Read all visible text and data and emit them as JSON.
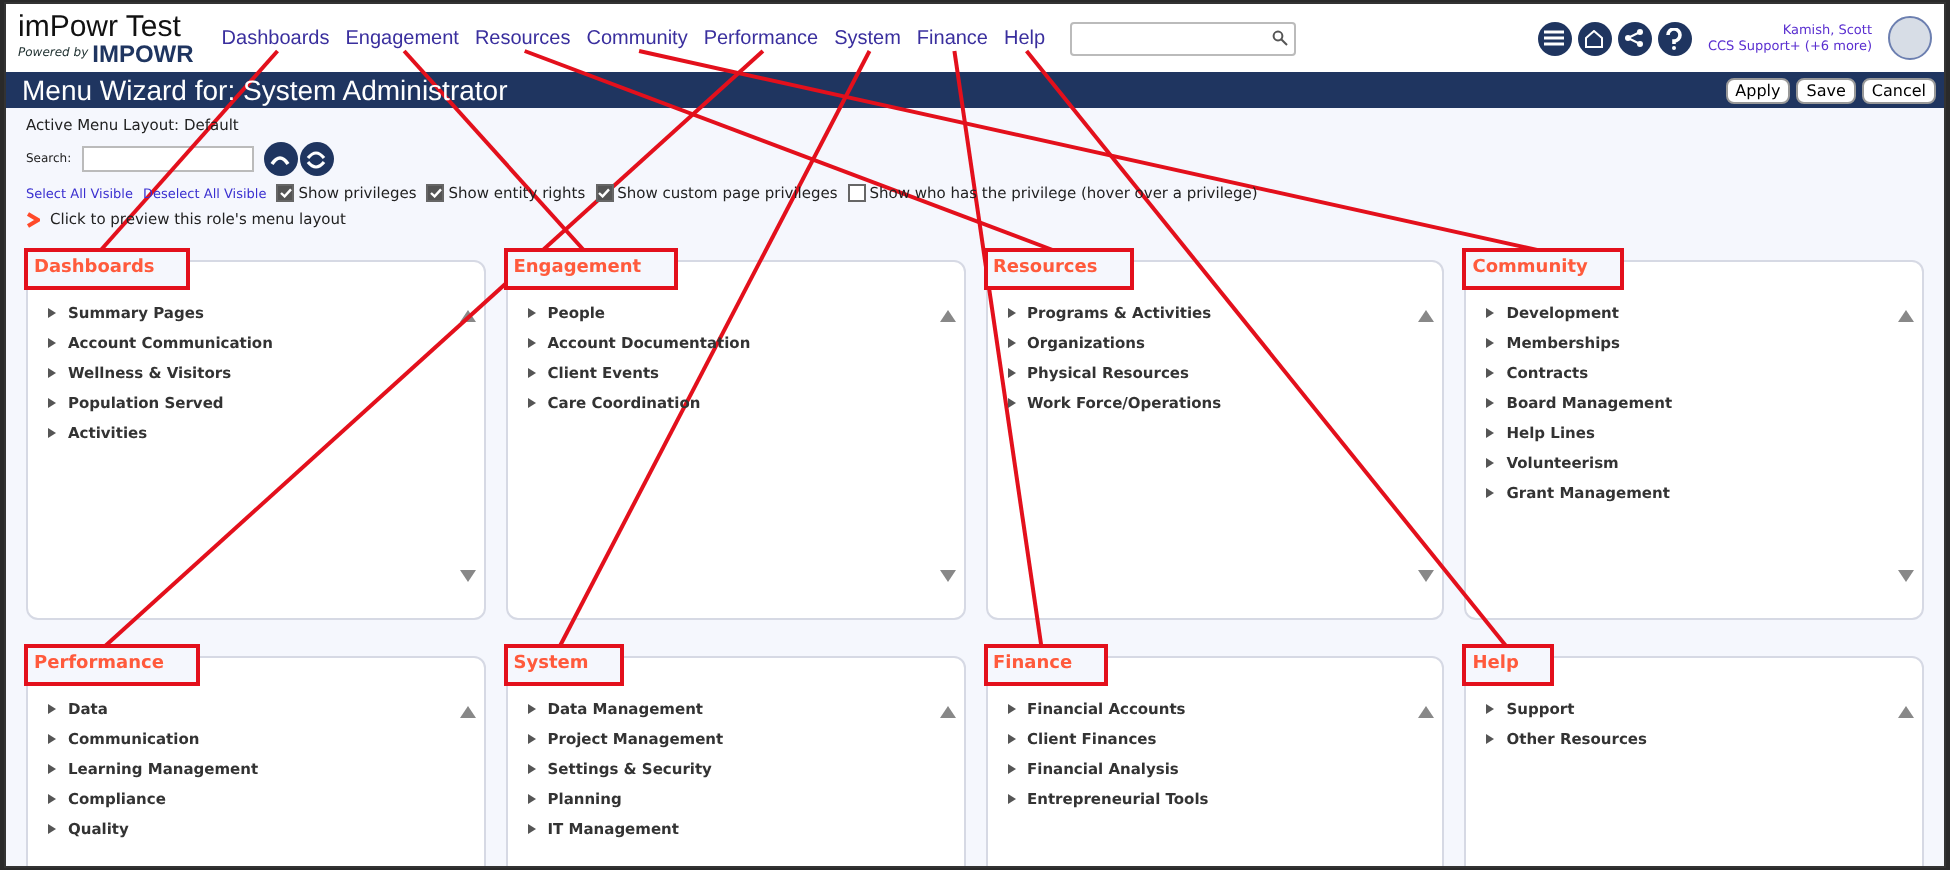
{
  "brand": {
    "title": "imPowr Test",
    "powered_by": "Powered by",
    "logo": "IMPOWR"
  },
  "nav": [
    "Dashboards",
    "Engagement",
    "Resources",
    "Community",
    "Performance",
    "System",
    "Finance",
    "Help"
  ],
  "user": {
    "name": "Kamish, Scott",
    "role": "CCS Support+ (+6 more)"
  },
  "title_bar": {
    "title": "Menu Wizard for: System Administrator",
    "buttons": [
      "Apply",
      "Save",
      "Cancel"
    ]
  },
  "layout_label": "Active Menu Layout: Default",
  "search_label": "Search:",
  "select_links": [
    "Select All Visible",
    "Deselect All Visible"
  ],
  "options": [
    {
      "label": "Show privileges",
      "checked": true
    },
    {
      "label": "Show entity rights",
      "checked": true
    },
    {
      "label": "Show custom page privileges",
      "checked": true
    },
    {
      "label": "Show who has the privilege (hover over a privilege)",
      "checked": false
    }
  ],
  "preview_link": "Click to preview this role's menu layout",
  "panels": [
    {
      "title": "Dashboards",
      "items": [
        "Summary Pages",
        "Account Communication",
        "Wellness & Visitors",
        "Population Served",
        "Activities"
      ]
    },
    {
      "title": "Engagement",
      "items": [
        "People",
        "Account Documentation",
        "Client Events",
        "Care Coordination"
      ]
    },
    {
      "title": "Resources",
      "items": [
        "Programs & Activities",
        "Organizations",
        "Physical Resources",
        "Work Force/Operations"
      ]
    },
    {
      "title": "Community",
      "items": [
        "Development",
        "Memberships",
        "Contracts",
        "Board Management",
        "Help Lines",
        "Volunteerism",
        "Grant Management"
      ]
    },
    {
      "title": "Performance",
      "items": [
        "Data",
        "Communication",
        "Learning Management",
        "Compliance",
        "Quality"
      ]
    },
    {
      "title": "System",
      "items": [
        "Data Management",
        "Project Management",
        "Settings & Security",
        "Planning",
        "IT Management"
      ]
    },
    {
      "title": "Finance",
      "items": [
        "Financial Accounts",
        "Client Finances",
        "Financial Analysis",
        "Entrepreneurial Tools"
      ]
    },
    {
      "title": "Help",
      "items": [
        "Support",
        "Other Resources"
      ]
    }
  ]
}
